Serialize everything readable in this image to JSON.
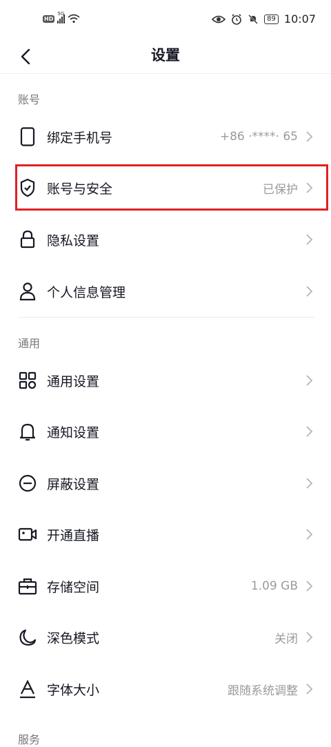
{
  "status_bar": {
    "hd": "HD",
    "network": "5G",
    "battery": "89",
    "time": "10:07"
  },
  "header": {
    "title": "设置"
  },
  "sections": {
    "account": "账号",
    "general": "通用",
    "services": "服务"
  },
  "account_items": [
    {
      "label": "绑定手机号",
      "value": "+86 ·****· 65",
      "icon": "phone-icon"
    },
    {
      "label": "账号与安全",
      "value": "已保护",
      "icon": "shield-check-icon"
    },
    {
      "label": "隐私设置",
      "value": "",
      "icon": "lock-icon"
    },
    {
      "label": "个人信息管理",
      "value": "",
      "icon": "person-icon"
    }
  ],
  "general_items": [
    {
      "label": "通用设置",
      "value": "",
      "icon": "grid-icon"
    },
    {
      "label": "通知设置",
      "value": "",
      "icon": "bell-icon"
    },
    {
      "label": "屏蔽设置",
      "value": "",
      "icon": "block-icon"
    },
    {
      "label": "开通直播",
      "value": "",
      "icon": "camera-icon"
    },
    {
      "label": "存储空间",
      "value": "1.09 GB",
      "icon": "storage-icon"
    },
    {
      "label": "深色模式",
      "value": "关闭",
      "icon": "moon-icon"
    },
    {
      "label": "字体大小",
      "value": "跟随系统调整",
      "icon": "font-size-icon"
    }
  ],
  "colors": {
    "highlight": "#e02020",
    "value_text": "#9a9aa0",
    "section_text": "#777777"
  }
}
